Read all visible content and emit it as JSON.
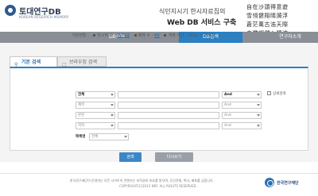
{
  "header": {
    "logo_title": "토대연구DB",
    "logo_sub": "KOREAN RESEARCH MEMORY",
    "hero_line1": "식민지시기 한시자료집의",
    "hero_line2": "Web DB 서비스 구축",
    "calligraphy": [
      "自在沙頭得意遊",
      "雪翎健翔晴漪浮",
      "蒼茫萬古浩天際",
      "白鷺翩然入碧流"
    ]
  },
  "nav": {
    "items": [
      {
        "label": "DB소개",
        "active": false
      },
      {
        "label": "DB검색",
        "active": true
      },
      {
        "label": "연구자소개",
        "active": false
      }
    ]
  },
  "tabs": [
    {
      "label": "기본 검색",
      "active": true
    },
    {
      "label": "브라우징 검색",
      "active": false
    }
  ],
  "stats": {
    "label": "기본현황 :",
    "works_label": "한시작 수 :",
    "works_value": "7,752",
    "journals_label": "매체 수 :",
    "journals_value": "43",
    "period_label": "게재 기간 :",
    "period_value": "1910 ~ 1943"
  },
  "search_rows": [
    {
      "field": "전체",
      "op": "And"
    },
    {
      "field": "제목",
      "op": "And"
    },
    {
      "field": "본문",
      "op": "And"
    },
    {
      "field": "저자",
      "op": "And"
    }
  ],
  "media": {
    "label": "매체명",
    "value": "전체"
  },
  "checkbox": {
    "label": "상세검색"
  },
  "buttons": {
    "search": "검색",
    "reset": "다시쓰기"
  },
  "footer": {
    "line1": "한국연구재단이 운영하는 모든 사이트의 콘텐츠는 저작권의 보호를 받으며, 무단전재, 복사, 배포를 금합니다.",
    "line2": "COPYRIGHT(C)2013 NRF. ALL RIGHTS RESERVED.",
    "logo_text": "한국연구재단"
  },
  "colors": {
    "accent": "#2c7fc0",
    "nav_bg": "#8a8f96"
  }
}
